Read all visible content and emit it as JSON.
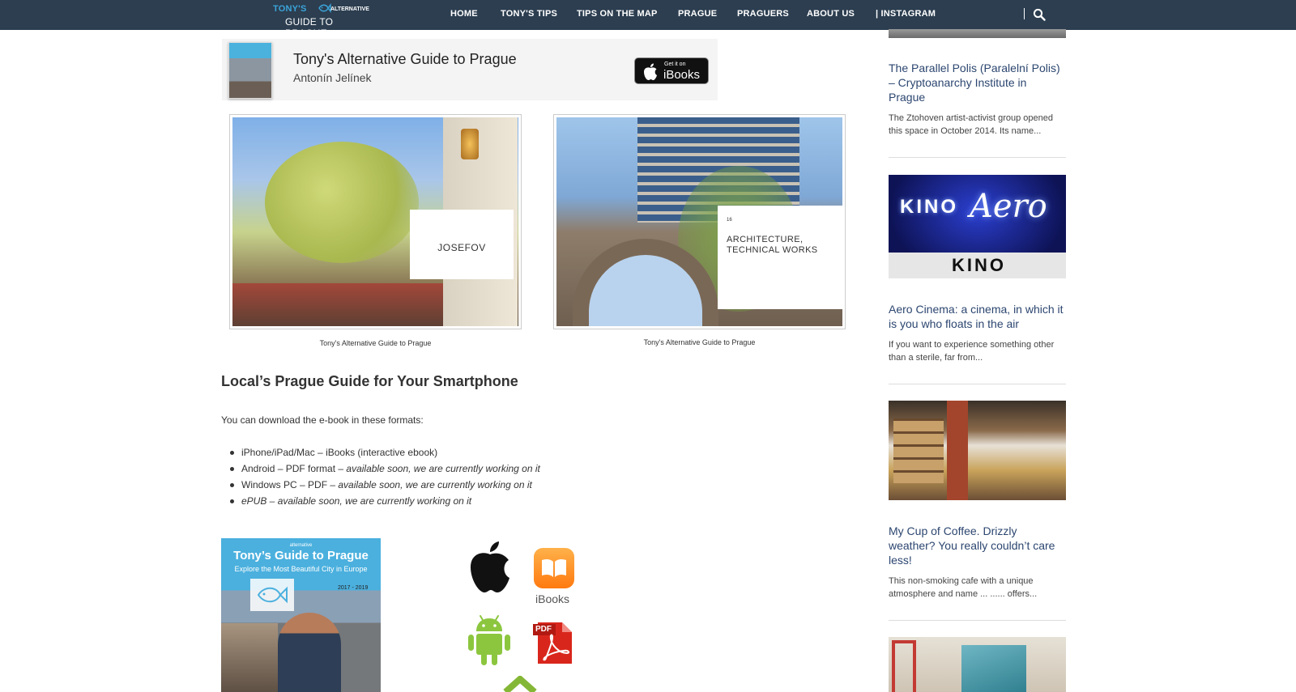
{
  "nav": {
    "logo_line1": "TONY'S",
    "logo_line1b": "ALTERNATIVE",
    "logo_line2": "GUIDE TO PRAGUE",
    "items": [
      "HOME",
      "TONY'S TIPS",
      "TIPS ON THE MAP",
      "PRAGUE",
      "PRAGUERS",
      "ABOUT US",
      "| INSTAGRAM"
    ],
    "colors": {
      "bar": "#2c3e50",
      "logo_accent": "#3ba4d9"
    }
  },
  "ibook": {
    "title": "Tony's Alternative Guide to Prague",
    "author": "Antonín Jelínek",
    "badge_small": "Get it on",
    "badge_large": "iBooks"
  },
  "gallery": [
    {
      "label": "JOSEFOV",
      "caption": "Tony's Alternative Guide to Prague"
    },
    {
      "number": "16",
      "label_line1": "ARCHITECTURE,",
      "label_line2": "TECHNICAL WORKS",
      "caption": "Tony's Alternative Guide to Prague"
    }
  ],
  "content": {
    "heading": "Local’s Prague Guide for Your Smartphone",
    "intro": "You can download the e-book in these formats:",
    "formats": [
      {
        "plain": "iPhone/iPad/Mac – iBooks (interactive ebook)",
        "note": ""
      },
      {
        "plain": "Android – PDF format – ",
        "note": "available soon, we are currently working on it"
      },
      {
        "plain": "Windows PC – PDF – ",
        "note": "available soon, we are currently working on it"
      },
      {
        "plain": "",
        "note": "ePUB – available soon, we are currently working on it"
      }
    ]
  },
  "book_cover": {
    "small": "alternative",
    "title": "Tony’s Guide to Prague",
    "subtitle": "Explore the Most Beautiful City in Europe",
    "years": "2017 - 2019"
  },
  "platform_icons": {
    "ibooks_label": "iBooks",
    "pdf_label": "PDF",
    "items": [
      "apple-icon",
      "ibooks-icon",
      "android-icon",
      "pdf-icon"
    ]
  },
  "sidebar": {
    "posts": [
      {
        "title": "The Parallel Polis (Paralelní Polis) – Cryptoanarchy Institute in Prague",
        "excerpt": "The Ztohoven artist-activist group opened this space in October 2014. Its name..."
      },
      {
        "title": "Aero Cinema: a cinema, in which it is you who floats in the air",
        "excerpt": "If you want to experience something other than a sterile, far from...",
        "image_text_1": "KINO",
        "image_text_2": "Aero",
        "image_text_3": "KINO"
      },
      {
        "title": "My Cup of Coffee. Drizzly weather? You really couldn’t care less!",
        "excerpt": "This non-smoking cafe with a unique atmosphere and name ... ...... offers..."
      }
    ],
    "colors": {
      "title": "#2c4670"
    }
  }
}
